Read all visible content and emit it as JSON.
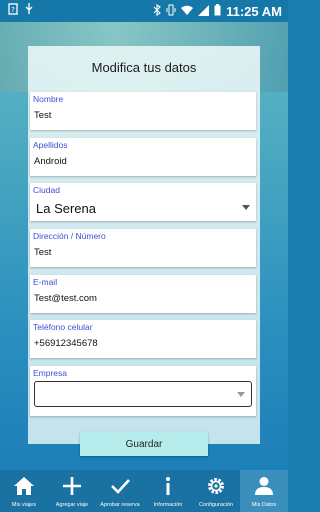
{
  "status": {
    "time": "11:25 AM"
  },
  "header": {
    "title": "Modifica tus datos"
  },
  "form": {
    "nombre": {
      "label": "Nombre",
      "value": "Test"
    },
    "apellidos": {
      "label": "Apellidos",
      "value": "Android"
    },
    "ciudad": {
      "label": "Ciudad",
      "value": "La Serena"
    },
    "direccion": {
      "label": "Dirección / Número",
      "value": "Test"
    },
    "email": {
      "label": "E-mail",
      "value": "Test@test.com"
    },
    "telefono": {
      "label": "Teléfono celular",
      "value": "+56912345678"
    },
    "empresa": {
      "label": "Empresa",
      "value": ""
    }
  },
  "actions": {
    "save_label": "Guardar"
  },
  "nav": [
    {
      "label": "Mis viajes",
      "icon": "home-icon"
    },
    {
      "label": "Agregar viaje",
      "icon": "plus-icon"
    },
    {
      "label": "Aprobar reserva",
      "icon": "check-icon"
    },
    {
      "label": "Información",
      "icon": "info-icon"
    },
    {
      "label": "Configuración",
      "icon": "gear-icon"
    },
    {
      "label": "Mis Datos",
      "icon": "person-icon"
    }
  ],
  "colors": {
    "accent": "#1a72a3",
    "label": "#3b4fd8",
    "button": "#b7ecec"
  }
}
